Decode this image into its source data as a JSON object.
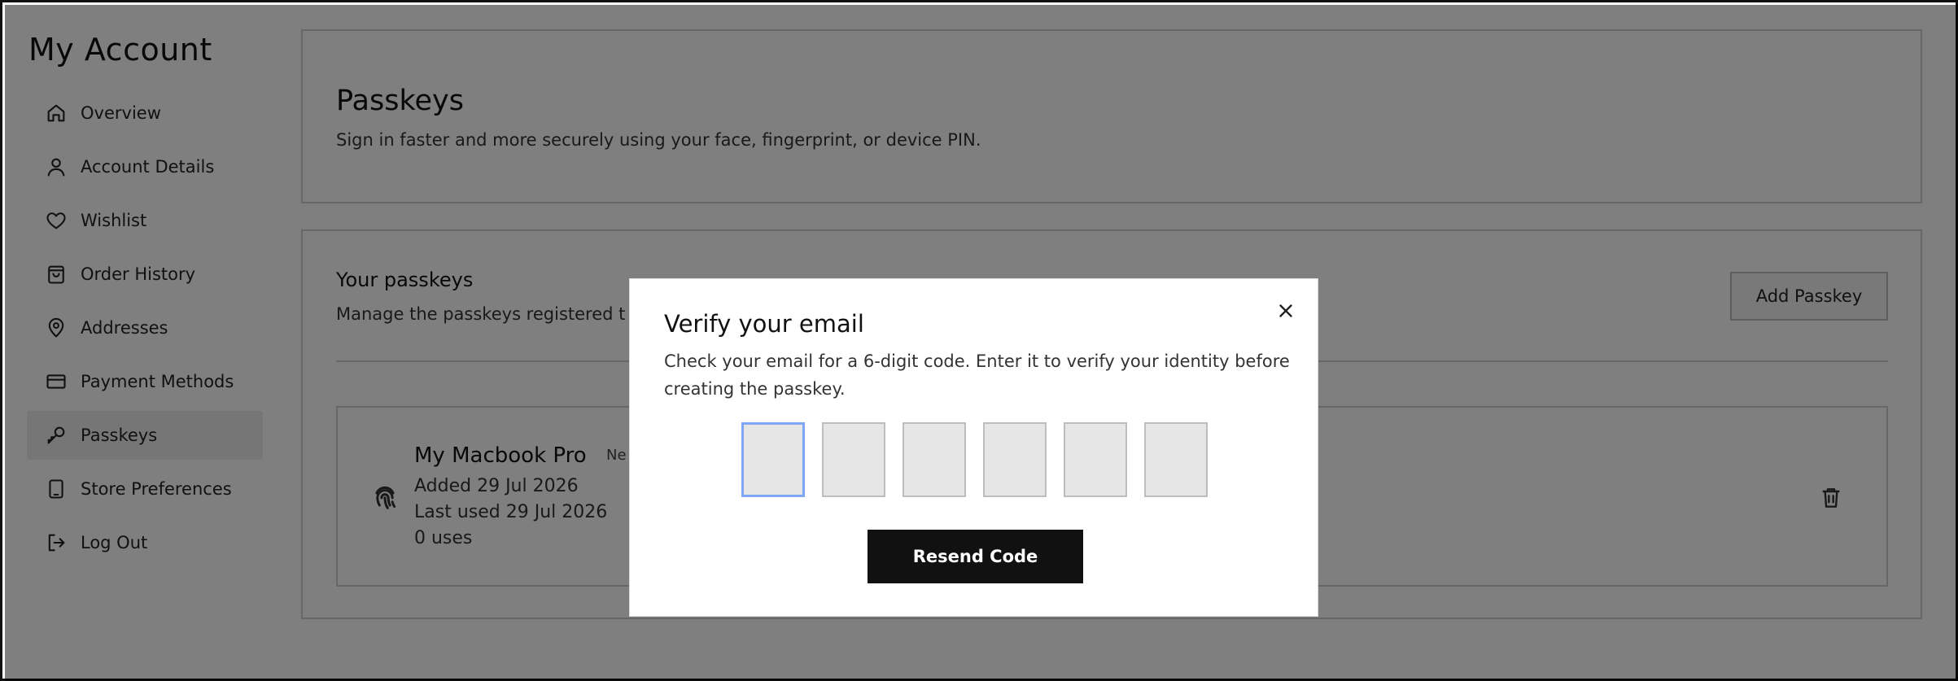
{
  "sidebar": {
    "title": "My Account",
    "items": [
      {
        "label": "Overview",
        "icon": "home-icon"
      },
      {
        "label": "Account Details",
        "icon": "user-icon"
      },
      {
        "label": "Wishlist",
        "icon": "heart-icon"
      },
      {
        "label": "Order History",
        "icon": "bag-icon"
      },
      {
        "label": "Addresses",
        "icon": "location-pin-icon"
      },
      {
        "label": "Payment Methods",
        "icon": "credit-card-icon"
      },
      {
        "label": "Passkeys",
        "icon": "key-icon",
        "active": true
      },
      {
        "label": "Store Preferences",
        "icon": "device-icon"
      },
      {
        "label": "Log Out",
        "icon": "logout-icon"
      }
    ]
  },
  "header": {
    "title": "Passkeys",
    "subtitle": "Sign in faster and more securely using your face, fingerprint, or device PIN."
  },
  "passkeys_section": {
    "title": "Your passkeys",
    "description": "Manage the passkeys registered t",
    "add_button": "Add Passkey",
    "items": [
      {
        "name": "My Macbook Pro",
        "badge": "Ne",
        "added": "Added 29 Jul 2026",
        "last_used": "Last used 29 Jul 2026",
        "uses": "0 uses"
      }
    ]
  },
  "modal": {
    "title": "Verify your email",
    "description": "Check your email for a 6-digit code. Enter it to verify your identity before creating the passkey.",
    "code_digits": [
      "",
      "",
      "",
      "",
      "",
      ""
    ],
    "resend_button": "Resend Code"
  },
  "colors": {
    "overlay": "#000000",
    "primary_button": "#111111",
    "focus_border": "#7ea6f5",
    "active_nav_bg": "#ececec"
  }
}
